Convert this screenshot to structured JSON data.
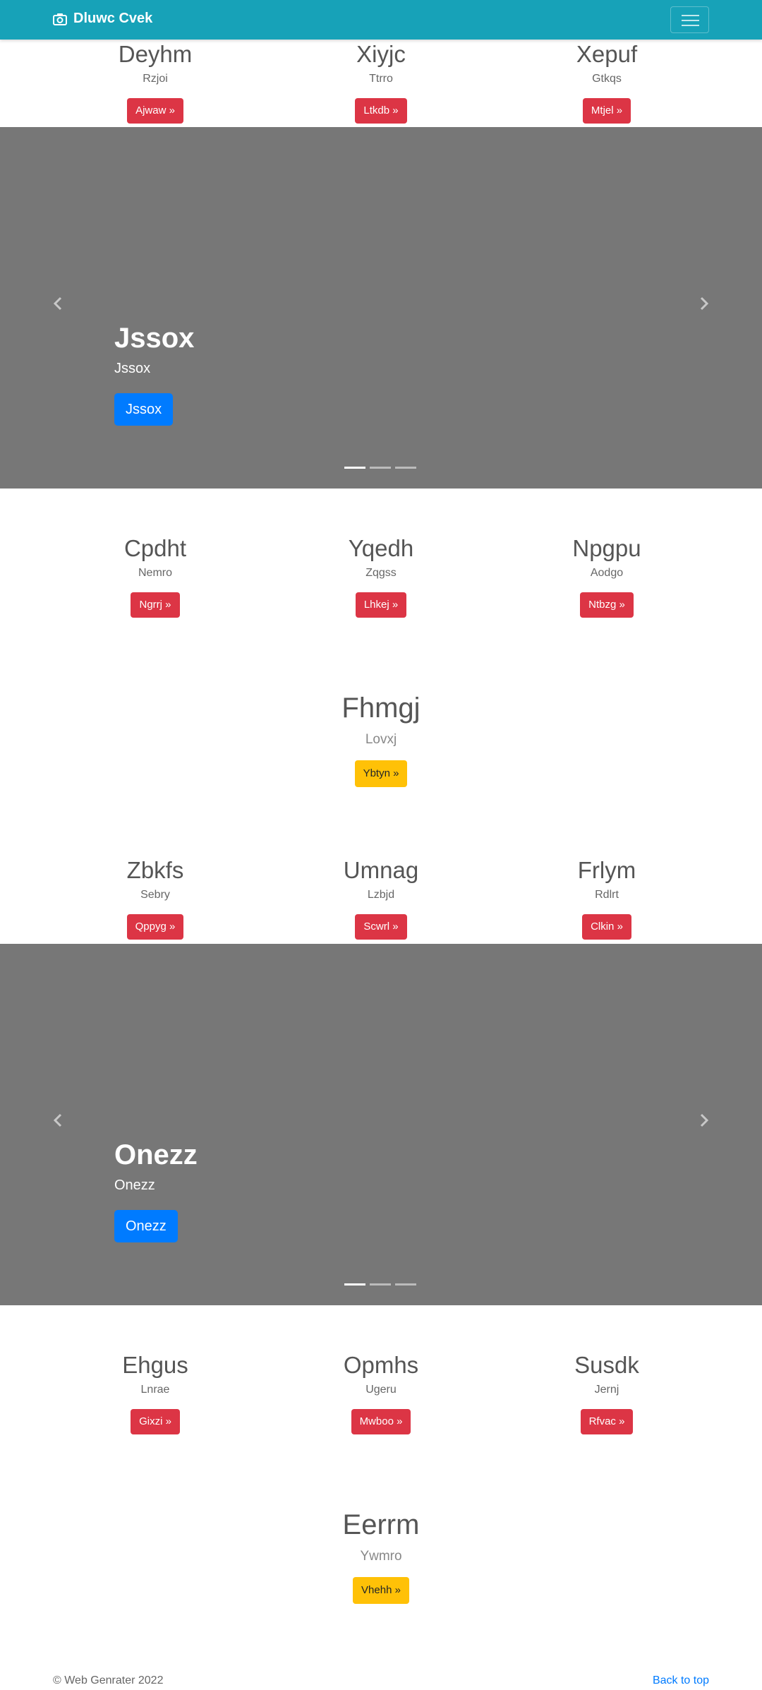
{
  "navbar": {
    "brand": "Dluwc Cvek",
    "camera_icon": "camera-icon",
    "menu_icon": "hamburger-menu-icon"
  },
  "top_cols": [
    {
      "title": "Deyhm",
      "sub": "Rzjoi",
      "btn": "Ajwaw »"
    },
    {
      "title": "Xiyjc",
      "sub": "Ttrro",
      "btn": "Ltkdb »"
    },
    {
      "title": "Xepuf",
      "sub": "Gtkqs",
      "btn": "Mtjel »"
    }
  ],
  "carousel1": {
    "title": "Jssox",
    "text": "Jssox",
    "btn": "Jssox"
  },
  "row2": [
    {
      "title": "Cpdht",
      "sub": "Nemro",
      "btn": "Ngrrj »"
    },
    {
      "title": "Yqedh",
      "sub": "Zqgss",
      "btn": "Lhkej »"
    },
    {
      "title": "Npgpu",
      "sub": "Aodgo",
      "btn": "Ntbzg »"
    }
  ],
  "feature1": {
    "title": "Fhmgj",
    "sub": "Lovxj",
    "btn": "Ybtyn »"
  },
  "row3": [
    {
      "title": "Zbkfs",
      "sub": "Sebry",
      "btn": "Qppyg »"
    },
    {
      "title": "Umnag",
      "sub": "Lzbjd",
      "btn": "Scwrl »"
    },
    {
      "title": "Frlym",
      "sub": "Rdlrt",
      "btn": "Clkin »"
    }
  ],
  "carousel2": {
    "title": "Onezz",
    "text": "Onezz",
    "btn": "Onezz"
  },
  "row4": [
    {
      "title": "Ehgus",
      "sub": "Lnrae",
      "btn": "Gixzi »"
    },
    {
      "title": "Opmhs",
      "sub": "Ugeru",
      "btn": "Mwboo »"
    },
    {
      "title": "Susdk",
      "sub": "Jernj",
      "btn": "Rfvac »"
    }
  ],
  "feature2": {
    "title": "Eerrm",
    "sub": "Ywmro",
    "btn": "Vhehh »"
  },
  "footer": {
    "copyright": "© Web Genrater 2022",
    "back_to_top": "Back to top"
  },
  "colors": {
    "navbar": "#17a2b8",
    "danger": "#dc3545",
    "warning": "#ffc107",
    "primary": "#007bff",
    "carousel_bg": "#777777"
  }
}
